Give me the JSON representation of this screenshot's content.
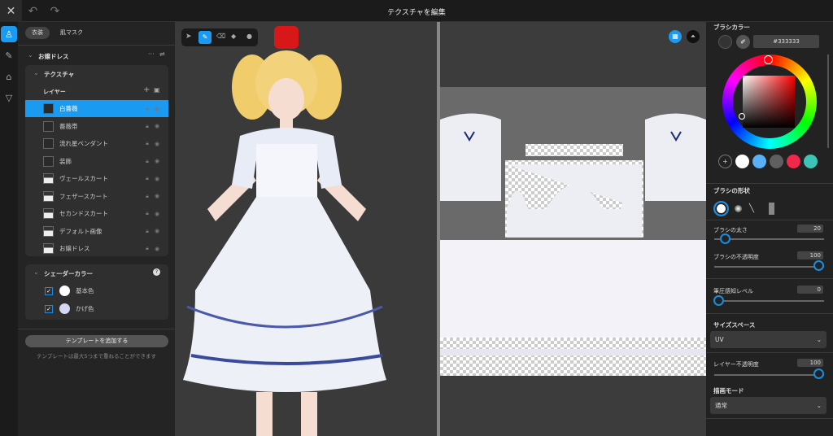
{
  "header": {
    "title": "テクスチャを編集",
    "close": "✕",
    "undo": "↶",
    "redo": "↷"
  },
  "left": {
    "tabs": [
      "衣装",
      "肌マスク"
    ],
    "outfit": "お嬢ドレス",
    "texture_section": "テクスチャ",
    "layers_label": "レイヤー",
    "layers": [
      "白薔薇",
      "薔薇帯",
      "流れ星ペンダント",
      "装飾",
      "ヴェールスカート",
      "フェザースカート",
      "セカンドスカート",
      "デフォルト画像",
      "お嬢ドレス"
    ],
    "selected_layer": 0,
    "shader_section": "シェーダーカラー",
    "shader_colors": [
      {
        "label": "基本色",
        "color": "#ffffff"
      },
      {
        "label": "かげ色",
        "color": "#d4d8f5"
      }
    ],
    "add_template": "テンプレートを追加する",
    "template_note": "テンプレートは最大5つまで重ねることができます"
  },
  "right": {
    "brush_color_label": "ブラシカラー",
    "hex": "#333333",
    "swatches": [
      "#ffffff",
      "#5ab0f5",
      "#5f5f5f",
      "#f0284a",
      "#3ec4b4"
    ],
    "brush_shape_label": "ブラシの形状",
    "size_label": "ブラシの太さ",
    "size": 20,
    "opacity_label": "ブラシの不透明度",
    "opacity": 100,
    "pressure_label": "筆圧感知レベル",
    "pressure": 0,
    "size_space_label": "サイズスペース",
    "size_space": "UV",
    "layer_opacity_label": "レイヤー不透明度",
    "layer_opacity": 100,
    "blend_label": "描画モード",
    "blend": "通常"
  },
  "colors": {
    "accent": "#1a9af0"
  }
}
